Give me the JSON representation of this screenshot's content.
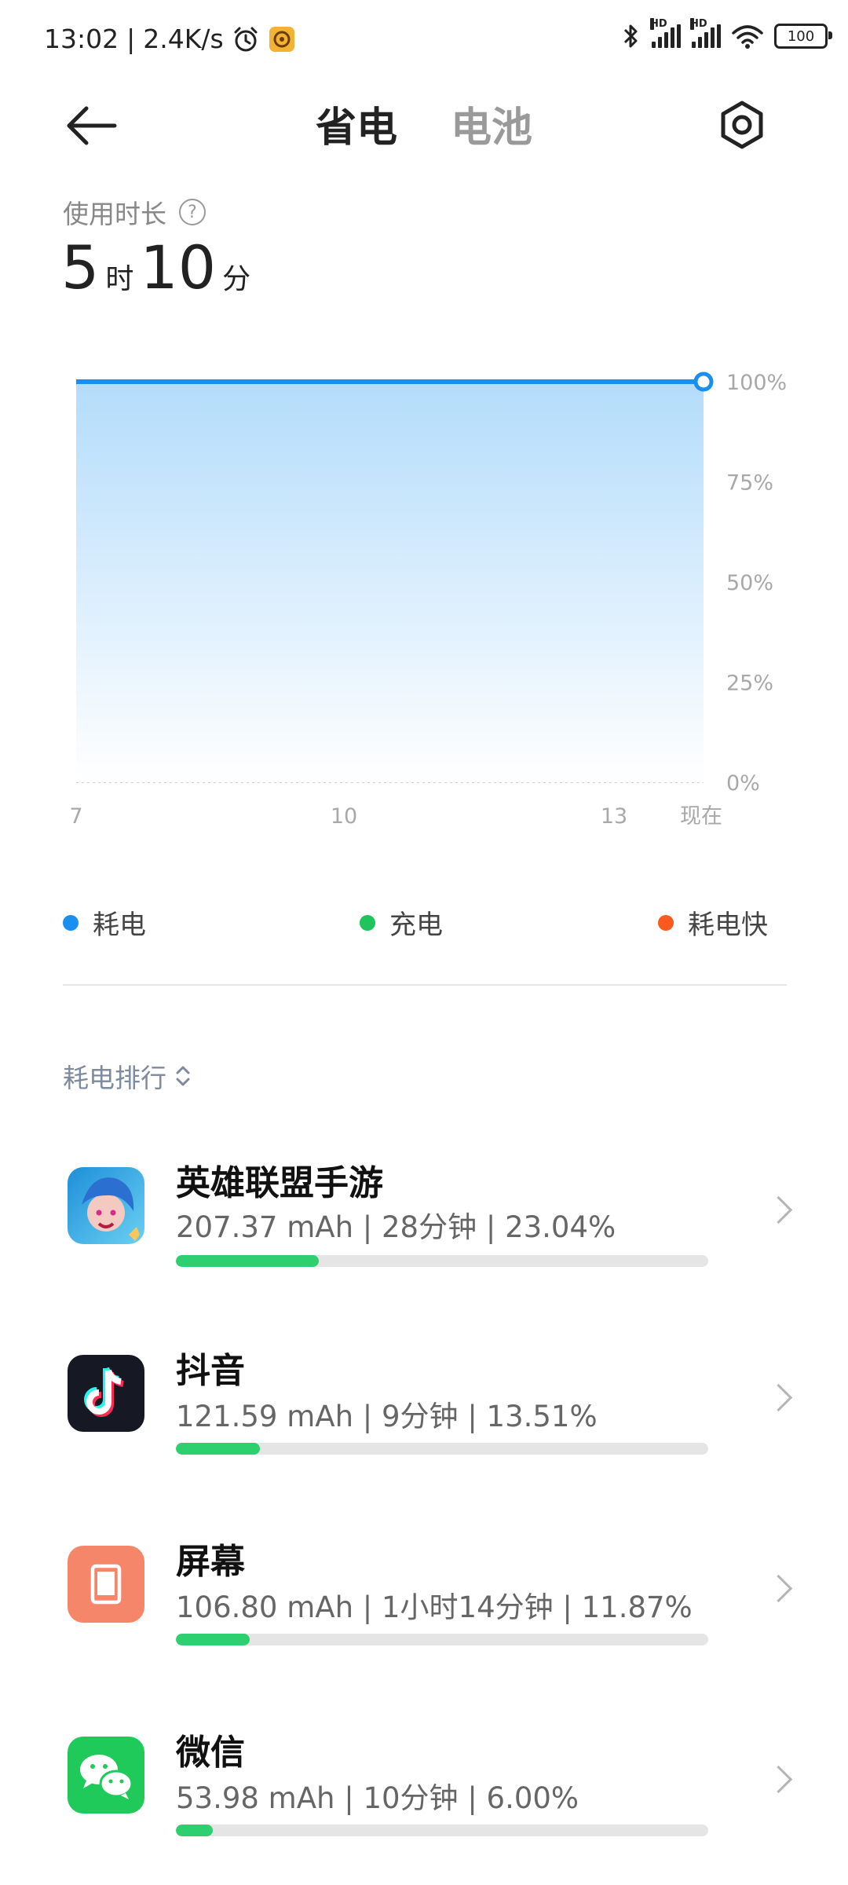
{
  "status_bar": {
    "time": "13:02",
    "speed": "2.4K/s",
    "battery": "100",
    "icons": [
      "alarm-icon",
      "app-notification-icon",
      "bluetooth-icon",
      "signal-hd-icon",
      "signal-hd-icon",
      "wifi-icon",
      "battery-icon"
    ]
  },
  "header": {
    "tabs": [
      {
        "label": "省电"
      },
      {
        "label": "电池"
      }
    ]
  },
  "usage": {
    "label": "使用时长",
    "hours": "5",
    "hours_unit": "时",
    "minutes": "10",
    "minutes_unit": "分"
  },
  "chart_data": {
    "type": "area",
    "x_tick_labels": [
      "7",
      "10",
      "13",
      "现在"
    ],
    "y_tick_labels": [
      "100%",
      "75%",
      "50%",
      "25%",
      "0%"
    ],
    "ylim": [
      0,
      100
    ],
    "series": [
      {
        "points": [
          {
            "x": "7",
            "y": 100
          },
          {
            "x": "现在",
            "y": 100
          }
        ]
      }
    ],
    "grid": true,
    "line_color": "#1a8ff0"
  },
  "legend": [
    {
      "label": "耗电",
      "color": "#1a8ff0"
    },
    {
      "label": "充电",
      "color": "#1fc45a"
    },
    {
      "label": "耗电快",
      "color": "#fa5a1e"
    }
  ],
  "ranking": {
    "label": "耗电排行"
  },
  "apps": [
    {
      "name": "英雄联盟手游",
      "stats": "207.37 mAh | 28分钟 | 23.04%",
      "share": 23.04,
      "icon": "league-of-legends-icon"
    },
    {
      "name": "抖音",
      "stats": "121.59 mAh | 9分钟 | 13.51%",
      "share": 13.51,
      "icon": "douyin-icon"
    },
    {
      "name": "屏幕",
      "stats": "106.80 mAh | 1小时14分钟 | 11.87%",
      "share": 11.87,
      "icon": "screen-icon"
    },
    {
      "name": "微信",
      "stats": "53.98 mAh | 10分钟 | 6.00%",
      "share": 6.0,
      "icon": "wechat-icon"
    }
  ]
}
